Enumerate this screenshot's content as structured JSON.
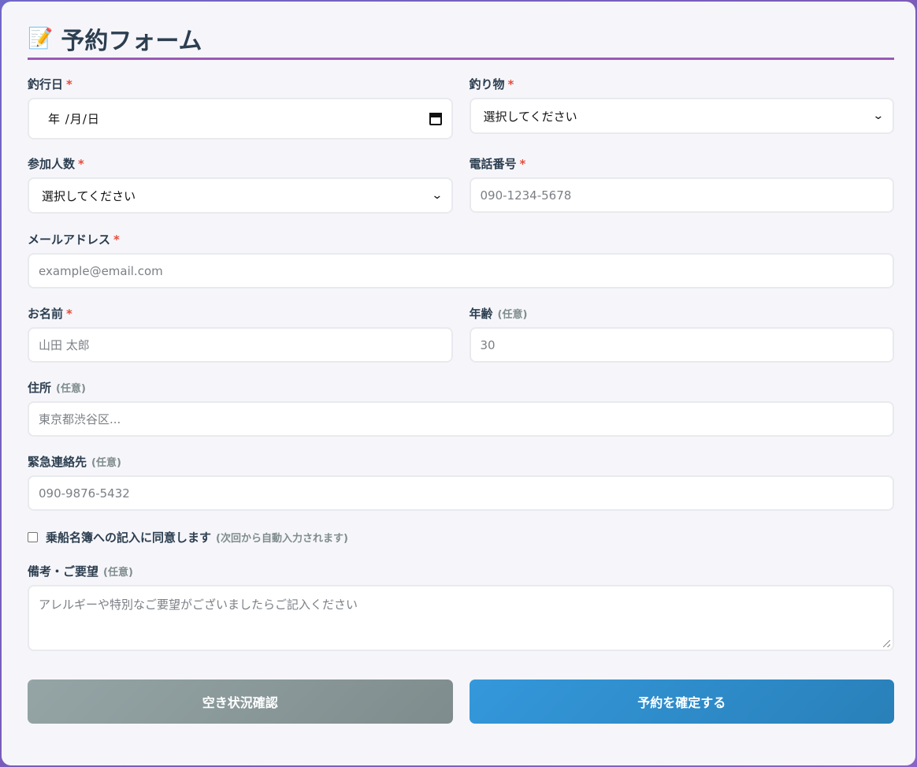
{
  "header": {
    "icon": "memo-icon",
    "title": "予約フォーム"
  },
  "required_mark": "*",
  "fields": {
    "fishing_date": {
      "label": "釣行日",
      "value": "年 /月/日"
    },
    "target_fish": {
      "label": "釣り物",
      "value": "選択してください"
    },
    "participants": {
      "label": "参加人数",
      "value": "選択してください"
    },
    "phone": {
      "label": "電話番号",
      "placeholder": "090-1234-5678"
    },
    "email": {
      "label": "メールアドレス",
      "placeholder": "example@email.com"
    },
    "name": {
      "label": "お名前",
      "placeholder": "山田 太郎"
    },
    "age": {
      "label": "年齢",
      "optional": "(任意)",
      "placeholder": "30"
    },
    "address": {
      "label": "住所",
      "optional": "(任意)",
      "placeholder": "東京都渋谷区..."
    },
    "emergency_contact": {
      "label": "緊急連絡先",
      "optional": "(任意)",
      "placeholder": "090-9876-5432"
    },
    "consent": {
      "label": "乗船名簿への記入に同意します",
      "note": "(次回から自動入力されます)"
    },
    "remarks": {
      "label": "備考・ご要望",
      "optional": "(任意)",
      "placeholder": "アレルギーや特別なご要望がございましたらご記入ください"
    }
  },
  "buttons": {
    "check_availability": "空き状況確認",
    "confirm": "予約を確定する"
  },
  "colors": {
    "accent": "#9b59b6",
    "required": "#e74c3c",
    "primary": "#3498db",
    "secondary": "#95a5a6"
  }
}
